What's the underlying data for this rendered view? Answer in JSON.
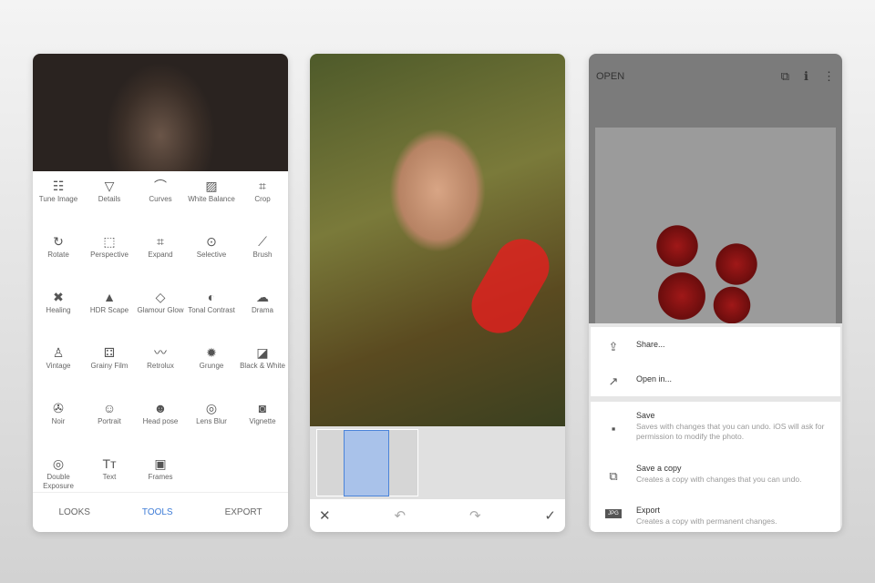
{
  "tools_panel": {
    "tools": [
      {
        "label": "Tune Image",
        "icon": "sliders-icon",
        "glyph": "☷"
      },
      {
        "label": "Details",
        "icon": "triangle-down-icon",
        "glyph": "▽"
      },
      {
        "label": "Curves",
        "icon": "curves-icon",
        "glyph": "⌒"
      },
      {
        "label": "White Balance",
        "icon": "white-balance-icon",
        "glyph": "▨"
      },
      {
        "label": "Crop",
        "icon": "crop-icon",
        "glyph": "⌗"
      },
      {
        "label": "Rotate",
        "icon": "rotate-icon",
        "glyph": "↻"
      },
      {
        "label": "Perspective",
        "icon": "perspective-icon",
        "glyph": "⬚"
      },
      {
        "label": "Expand",
        "icon": "expand-icon",
        "glyph": "⌗"
      },
      {
        "label": "Selective",
        "icon": "selective-icon",
        "glyph": "⊙"
      },
      {
        "label": "Brush",
        "icon": "brush-icon",
        "glyph": "⟋"
      },
      {
        "label": "Healing",
        "icon": "healing-icon",
        "glyph": "✖"
      },
      {
        "label": "HDR Scape",
        "icon": "mountains-icon",
        "glyph": "▲"
      },
      {
        "label": "Glamour Glow",
        "icon": "diamond-icon",
        "glyph": "◇"
      },
      {
        "label": "Tonal Contrast",
        "icon": "tonal-contrast-icon",
        "glyph": "◐"
      },
      {
        "label": "Drama",
        "icon": "cloud-icon",
        "glyph": "☁"
      },
      {
        "label": "Vintage",
        "icon": "lamp-icon",
        "glyph": "♙"
      },
      {
        "label": "Grainy Film",
        "icon": "grainy-film-icon",
        "glyph": "⚃"
      },
      {
        "label": "Retrolux",
        "icon": "mustache-icon",
        "glyph": "〰"
      },
      {
        "label": "Grunge",
        "icon": "grunge-icon",
        "glyph": "✹"
      },
      {
        "label": "Black & White",
        "icon": "black-white-icon",
        "glyph": "◪"
      },
      {
        "label": "Noir",
        "icon": "film-reel-icon",
        "glyph": "✇"
      },
      {
        "label": "Portrait",
        "icon": "face-icon",
        "glyph": "☺"
      },
      {
        "label": "Head pose",
        "icon": "head-pose-icon",
        "glyph": "☻"
      },
      {
        "label": "Lens Blur",
        "icon": "lens-blur-icon",
        "glyph": "◎"
      },
      {
        "label": "Vignette",
        "icon": "vignette-icon",
        "glyph": "◙"
      },
      {
        "label": "Double Exposure",
        "icon": "double-exposure-icon",
        "glyph": "◎"
      },
      {
        "label": "Text",
        "icon": "text-icon",
        "glyph": "Tт"
      },
      {
        "label": "Frames",
        "icon": "frames-icon",
        "glyph": "▣"
      }
    ],
    "nav": {
      "looks": "LOOKS",
      "tools": "TOOLS",
      "export": "EXPORT"
    },
    "accent": "#3d7bd6"
  },
  "brush_panel": {
    "cancel": "✕",
    "undo": "↶",
    "redo": "↷",
    "apply": "✓"
  },
  "export_panel": {
    "open_label": "OPEN",
    "header_icons": {
      "layers": "⧉",
      "info": "ℹ",
      "more": "⋮"
    },
    "menu": [
      {
        "icon": "share-icon",
        "glyph": "⇪",
        "title": "Share...",
        "desc": ""
      },
      {
        "icon": "open-in-icon",
        "glyph": "↗",
        "title": "Open in...",
        "desc": ""
      },
      {
        "icon": "save-icon",
        "glyph": "▪",
        "title": "Save",
        "desc": "Saves with changes that you can undo. iOS will ask for permission to modify the photo."
      },
      {
        "icon": "save-copy-icon",
        "glyph": "⧉",
        "title": "Save a copy",
        "desc": "Creates a copy with changes that you can undo."
      },
      {
        "icon": "jpg-icon",
        "glyph": "JPG",
        "title": "Export",
        "desc": "Creates a copy with permanent changes."
      }
    ]
  }
}
